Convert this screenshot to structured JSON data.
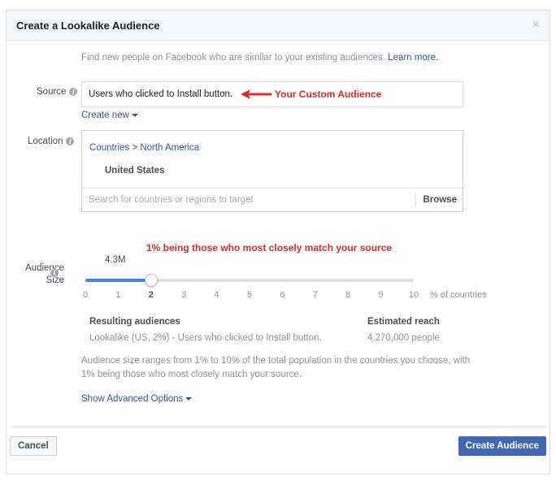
{
  "dialog": {
    "title": "Create a Lookalike Audience",
    "close_icon": "×"
  },
  "intro": {
    "text": "Find new people on Facebook who are similar to your existing audiences. ",
    "link": "Learn more."
  },
  "source": {
    "label": "Source",
    "value": "Users who clicked to Install button.",
    "annotation": "Your Custom Audience",
    "annotation_color": "#e02b2b",
    "create_new": "Create new"
  },
  "location": {
    "label": "Location",
    "crumb_countries": "Countries",
    "crumb_sep": " > ",
    "crumb_region": "North America",
    "selected_country": "United States",
    "search_placeholder": "Search for countries or regions to target",
    "browse": "Browse"
  },
  "audience_size": {
    "label_line1": "Audience",
    "label_line2": "Size",
    "annotation": "1% being those who most closely match your source",
    "size_value": "4.3M",
    "slider_min": 0,
    "slider_max": 10,
    "slider_value": 2,
    "ticks": [
      "0",
      "1",
      "2",
      "3",
      "4",
      "5",
      "6",
      "7",
      "8",
      "9",
      "10"
    ],
    "unit_label": "% of countries",
    "accent_color": "#4080ff"
  },
  "results": {
    "audiences_header": "Resulting audiences",
    "audiences_value": "Lookalike (US, 2%) - Users who clicked to Install button.",
    "reach_header": "Estimated reach",
    "reach_value": "4,270,000 people"
  },
  "note": "Audience size ranges from 1% to 10% of the total population in the countries you choose, with 1% being those who most closely match your source.",
  "advanced_options": "Show Advanced Options",
  "footer": {
    "cancel": "Cancel",
    "create": "Create Audience",
    "create_color": "#4267b2"
  }
}
